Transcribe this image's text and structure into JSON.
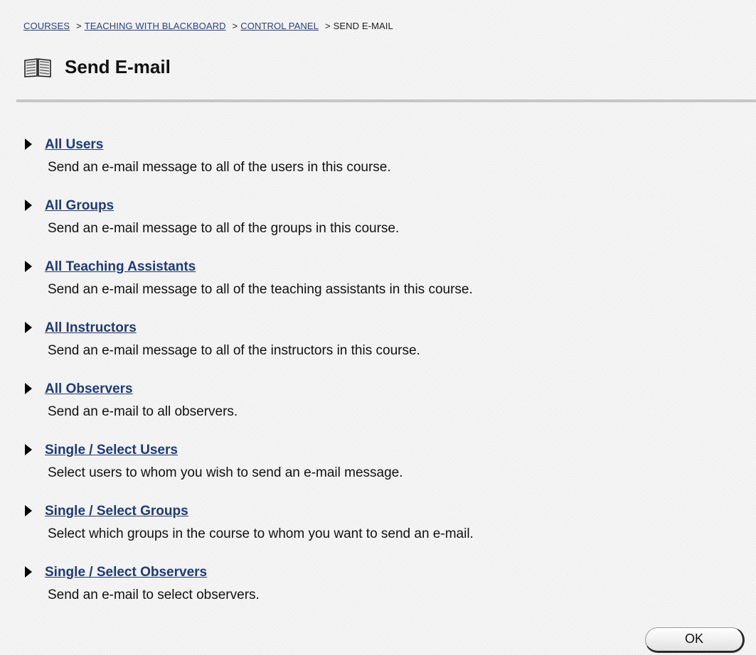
{
  "breadcrumb": {
    "items": [
      "COURSES",
      "TEACHING WITH BLACKBOARD",
      "CONTROL PANEL"
    ],
    "separator": ">",
    "current": "SEND E-MAIL"
  },
  "page": {
    "title": "Send E-mail",
    "icon": "book-icon"
  },
  "options": [
    {
      "label": "All Users",
      "description": "Send an e-mail message to all of the users in this course."
    },
    {
      "label": "All Groups",
      "description": "Send an e-mail message to all of the groups in this course."
    },
    {
      "label": "All Teaching Assistants",
      "description": "Send an e-mail message to all of the teaching assistants in this course."
    },
    {
      "label": "All Instructors",
      "description": "Send an e-mail message to all of the instructors in this course."
    },
    {
      "label": "All Observers",
      "description": "Send an e-mail to all observers."
    },
    {
      "label": "Single / Select Users",
      "description": "Select users to whom you wish to send an e-mail message."
    },
    {
      "label": "Single / Select Groups",
      "description": "Select which groups in the course to whom you want to send an e-mail."
    },
    {
      "label": "Single / Select Observers",
      "description": "Send an e-mail to select observers."
    }
  ],
  "ok_button": {
    "label": "OK"
  }
}
